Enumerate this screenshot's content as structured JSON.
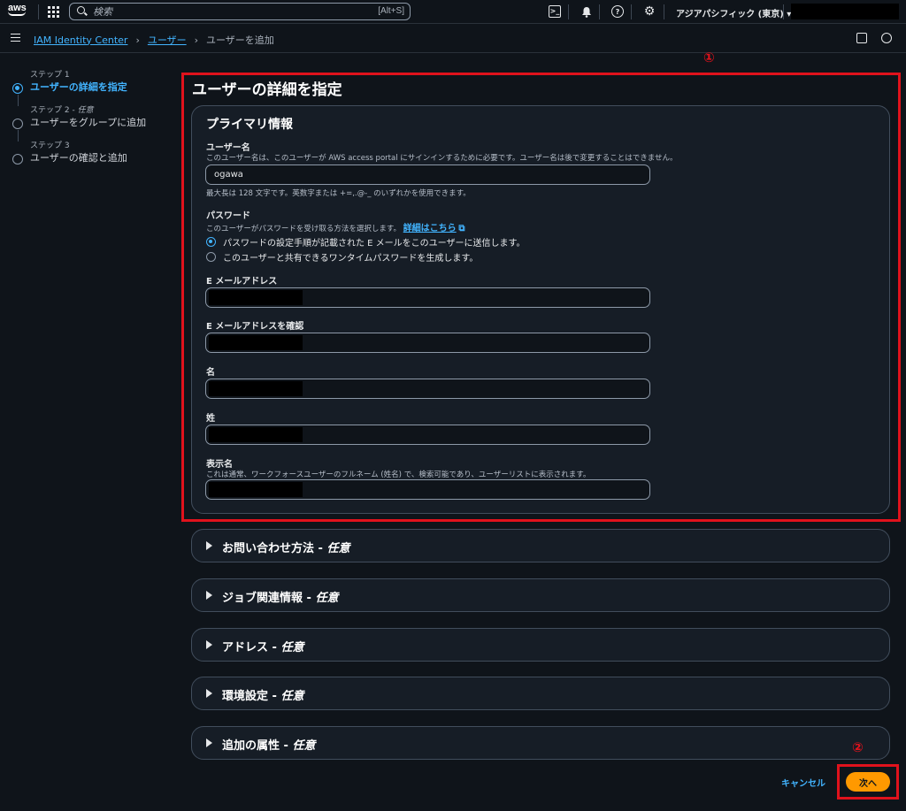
{
  "topbar": {
    "logo": "aws",
    "search_placeholder": "検索",
    "search_shortcut": "[Alt+S]",
    "region": "アジアパシフィック (東京) ▾",
    "icons": [
      "cloudshell-icon",
      "bell-icon",
      "help-icon",
      "gear-icon"
    ]
  },
  "breadcrumb": {
    "items": [
      "IAM Identity Center",
      "ユーザー",
      "ユーザーを追加"
    ],
    "separator": "›"
  },
  "steps": [
    {
      "small": "ステップ 1",
      "label": "ユーザーの詳細を指定",
      "active": true
    },
    {
      "small": "ステップ 2 - ",
      "small_em": "任意",
      "label": "ユーザーをグループに追加",
      "active": false
    },
    {
      "small": "ステップ 3",
      "label": "ユーザーの確認と追加",
      "active": false
    }
  ],
  "annotations": {
    "one": "①",
    "two": "②"
  },
  "page_title": "ユーザーの詳細を指定",
  "primary": {
    "heading": "プライマリ情報",
    "username": {
      "label": "ユーザー名",
      "desc": "このユーザー名は、このユーザーが AWS access portal にサインインするために必要です。ユーザー名は後で変更することはできません。",
      "value": "ogawa",
      "hint": "最大長は 128 文字です。英数字または +=,.@-_ のいずれかを使用できます。"
    },
    "password": {
      "label": "パスワード",
      "desc": "このユーザーがパスワードを受け取る方法を選択します。",
      "link": "詳細はこちら",
      "option1": "パスワードの設定手順が記載された E メールをこのユーザーに送信します。",
      "option2": "このユーザーと共有できるワンタイムパスワードを生成します。"
    },
    "email_label": "E メールアドレス",
    "email_confirm_label": "E メールアドレスを確認",
    "first_name_label": "名",
    "last_name_label": "姓",
    "display_name": {
      "label": "表示名",
      "desc": "これは通常、ワークフォースユーザーのフルネーム (姓名) で、検索可能であり、ユーザーリストに表示されます。"
    }
  },
  "sections": [
    {
      "title": "お問い合わせ方法 - ",
      "optional": "任意"
    },
    {
      "title": "ジョブ関連情報 - ",
      "optional": "任意"
    },
    {
      "title": "アドレス - ",
      "optional": "任意"
    },
    {
      "title": "環境設定 - ",
      "optional": "任意"
    },
    {
      "title": "追加の属性 - ",
      "optional": "任意"
    }
  ],
  "footer": {
    "cancel": "キャンセル",
    "next": "次へ"
  },
  "colors": {
    "accent": "#42b4ff",
    "primary_button": "#ff9900",
    "annotation": "#e0121c",
    "background": "#0f141a"
  }
}
